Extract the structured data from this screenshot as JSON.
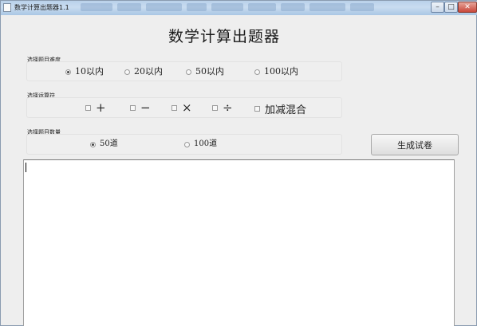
{
  "window": {
    "title": "数学计算出题器1.1"
  },
  "heading": "数学计算出题器",
  "difficulty": {
    "label": "选择题目难度",
    "options": [
      "10以内",
      "20以内",
      "50以内",
      "100以内"
    ],
    "selected": "10以内"
  },
  "operators": {
    "label": "选择运算符",
    "options": [
      "+",
      "−",
      "×",
      "÷",
      "加减混合"
    ],
    "checked": []
  },
  "count": {
    "label": "选择题目数量",
    "options": [
      "50道",
      "100道"
    ],
    "selected": "50道"
  },
  "generate_button": "生成试卷",
  "output": {
    "value": ""
  },
  "colors": {
    "title_bar": "#b9d1ea",
    "window_bg": "#eeeeee",
    "output_bg": "#ffffff"
  }
}
